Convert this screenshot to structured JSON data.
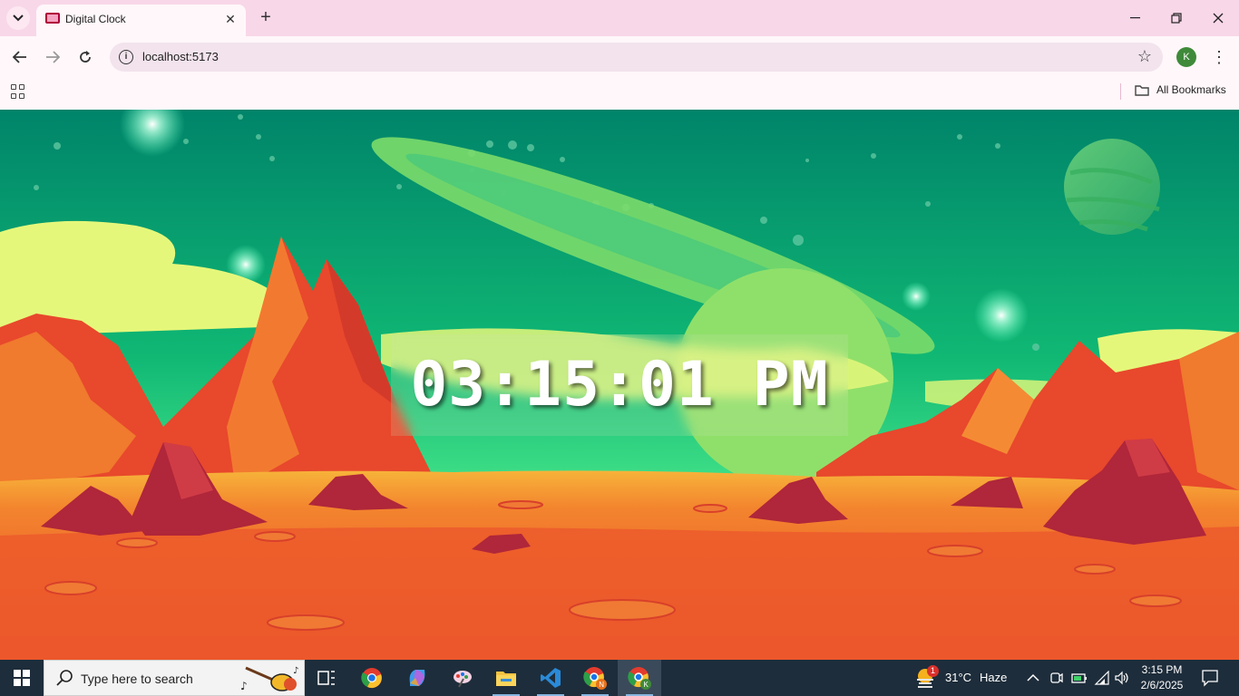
{
  "browser": {
    "tab_title": "Digital Clock",
    "url": "localhost:5173",
    "profile_initial": "K",
    "bookmarks_label": "All Bookmarks"
  },
  "page": {
    "clock_time": "03:15:01 PM"
  },
  "taskbar": {
    "search_placeholder": "Type here to search",
    "weather_temp": "31°C",
    "weather_desc": "Haze",
    "weather_badge": "1",
    "time": "3:15 PM",
    "date": "2/6/2025",
    "apps": [
      "task-view",
      "chrome",
      "copilot",
      "paint",
      "file-explorer",
      "vscode",
      "chrome-profile-n",
      "chrome-profile-k"
    ]
  },
  "colors": {
    "tabstrip": "#f8d7e8",
    "toolbar": "#fff7fa",
    "sky_top": "#00856a",
    "sky_bottom": "#3fe58a",
    "ground": "#f06a2a",
    "taskbar": "#1e2d3b"
  }
}
